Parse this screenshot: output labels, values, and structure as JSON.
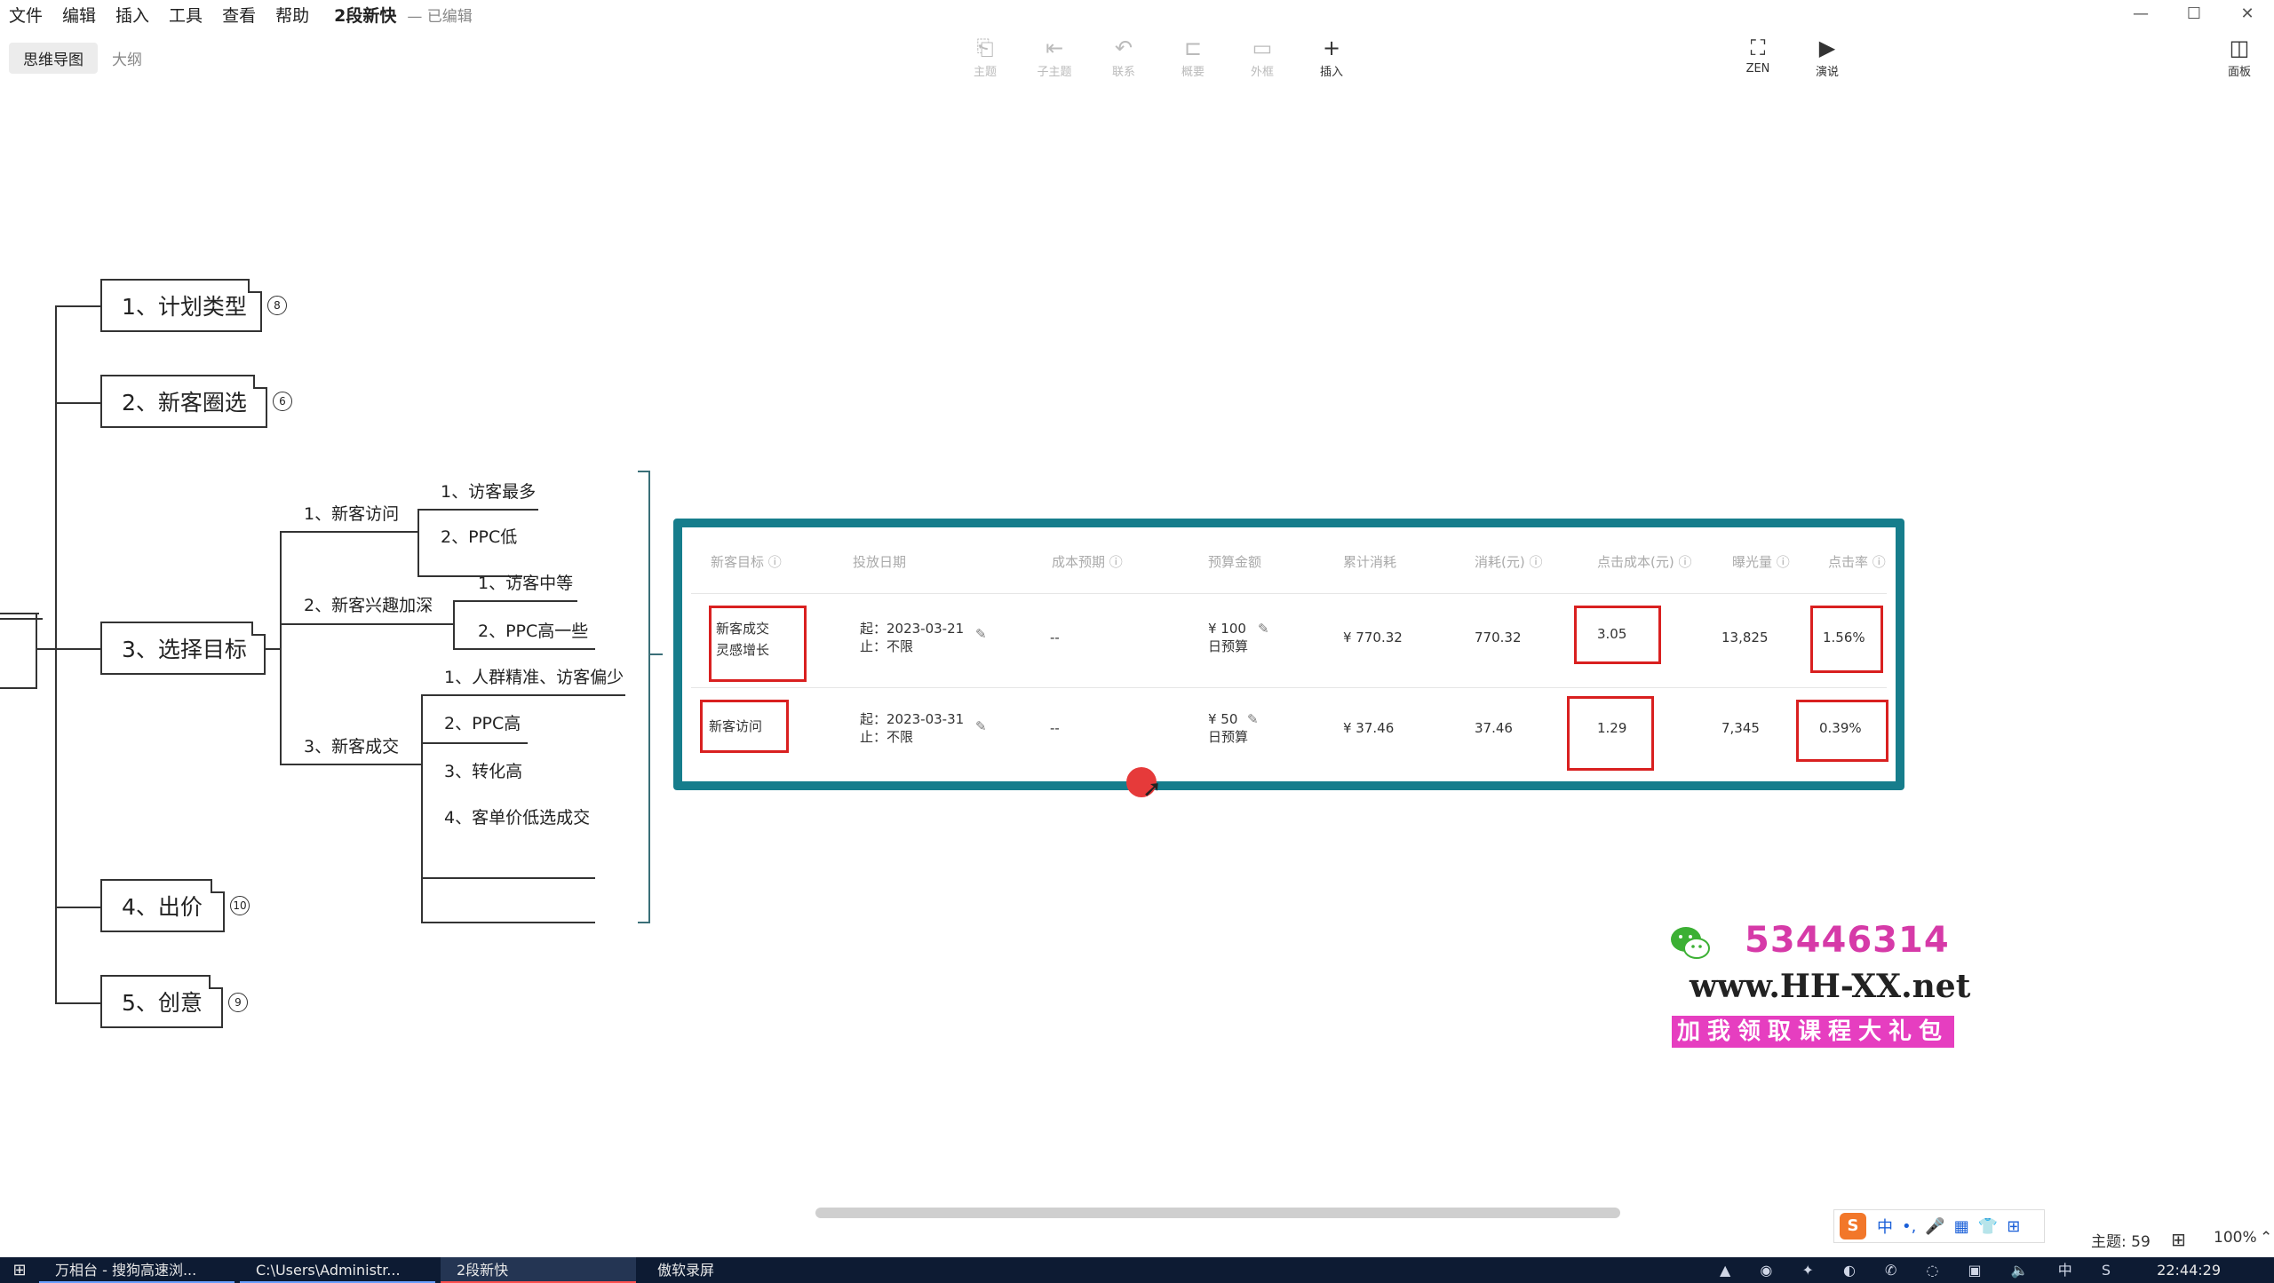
{
  "app": {
    "menu": [
      "文件",
      "编辑",
      "插入",
      "工具",
      "查看",
      "帮助"
    ],
    "doc_title": "2段新快",
    "doc_status": "— 已编辑",
    "window_controls": [
      "—",
      "☐",
      "✕"
    ]
  },
  "view_tabs": [
    {
      "label": "思维导图",
      "active": true
    },
    {
      "label": "大纲",
      "active": false
    }
  ],
  "toolbar": {
    "tools": [
      {
        "icon": "topic-icon",
        "glyph": "⎗",
        "label": "主题"
      },
      {
        "icon": "subtopic-icon",
        "glyph": "⇤",
        "label": "子主题"
      },
      {
        "icon": "relation-icon",
        "glyph": "↶",
        "label": "联系"
      },
      {
        "icon": "summary-icon",
        "glyph": "⊏",
        "label": "概要"
      },
      {
        "icon": "boundary-icon",
        "glyph": "▭",
        "label": "外框"
      },
      {
        "icon": "insert-icon",
        "glyph": "+",
        "label": "插入"
      }
    ],
    "right_tools": [
      {
        "icon": "zen-icon",
        "glyph": "⛶",
        "label": "ZEN"
      },
      {
        "icon": "present-icon",
        "glyph": "▶",
        "label": "演说"
      }
    ],
    "panel_tool": {
      "icon": "panel-icon",
      "glyph": "◫",
      "label": "面板"
    }
  },
  "mindmap": {
    "topics": [
      {
        "label": "1、计划类型",
        "badge": "8"
      },
      {
        "label": "2、新客圈选",
        "badge": "6"
      },
      {
        "label": "3、选择目标"
      },
      {
        "label": "4、出价",
        "badge": "10"
      },
      {
        "label": "5、创意",
        "badge": "9"
      }
    ],
    "target_branches": [
      {
        "label": "1、新客访问",
        "children": [
          "1、访客最多",
          "2、PPC低"
        ]
      },
      {
        "label": "2、新客兴趣加深",
        "children": [
          "1、访客中等",
          "2、PPC高一些"
        ]
      },
      {
        "label": "3、新客成交",
        "children": [
          "1、人群精准、访客偏少",
          "2、PPC高",
          "3、转化高",
          "4、客单价低选成交"
        ]
      }
    ]
  },
  "table": {
    "headers": [
      "新客目标 ⓘ",
      "投放日期",
      "成本预期 ⓘ",
      "预算金额",
      "累计消耗",
      "消耗(元) ⓘ",
      "点击成本(元) ⓘ",
      "曝光量 ⓘ",
      "点击率 ⓘ"
    ],
    "rows": [
      {
        "goal": "新客成交",
        "tag": "灵感增长",
        "date_start": "起：2023-03-21",
        "date_end": "止：不限",
        "cost_expect": "--",
        "budget": "¥ 100",
        "budget_type": "日预算",
        "total_spend": "¥ 770.32",
        "spend": "770.32",
        "cpc": "3.05",
        "impressions": "13,825",
        "ctr": "1.56%"
      },
      {
        "goal": "新客访问",
        "date_start": "起：2023-03-31",
        "date_end": "止：不限",
        "cost_expect": "--",
        "budget": "¥ 50",
        "budget_type": "日预算",
        "total_spend": "¥ 37.46",
        "spend": "37.46",
        "cpc": "1.29",
        "impressions": "7,345",
        "ctr": "0.39%"
      }
    ]
  },
  "watermark": {
    "qq": "53446314",
    "site": "www.HH-XX.net",
    "promo": "加我领取课程大礼包"
  },
  "ime": {
    "logo": "S",
    "items": [
      "中",
      "•,",
      "🎤",
      "▦",
      "👕",
      "⊞"
    ]
  },
  "status": {
    "topic_count": "主题: 59",
    "zoom": "100%"
  },
  "taskbar": {
    "tasks": [
      {
        "label": "万相台 - 搜狗高速浏...",
        "active": false
      },
      {
        "label": "C:\\Users\\Administr...",
        "active": false
      },
      {
        "label": "2段新快",
        "active": true
      },
      {
        "label": "傲软录屏",
        "active": false
      }
    ],
    "tray": "▲ ◉ ✦ ◐ ✆ ◌ ▣ 🔈 中 S",
    "clock": "22:44:29"
  },
  "colors": {
    "panel_border": "#167d8c",
    "highlight_box": "#d92020",
    "watermark_pink": "#e63ec0",
    "taskbar": "#0d1b33"
  }
}
